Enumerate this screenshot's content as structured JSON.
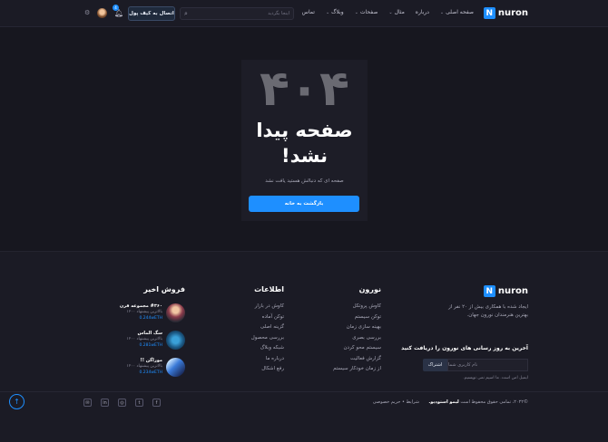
{
  "colors": {
    "accent": "#1e8fff",
    "background": "#17171f",
    "card": "#1d1d27",
    "text_muted": "#a9a9b8"
  },
  "header": {
    "logo_letter": "N",
    "logo_text": "nuron",
    "nav": [
      {
        "label": "صفحه اصلی",
        "chevron": true
      },
      {
        "label": "درباره",
        "chevron": false
      },
      {
        "label": "مثال",
        "chevron": true
      },
      {
        "label": "صفحات",
        "chevron": true
      },
      {
        "label": "وبلاگ",
        "chevron": true
      },
      {
        "label": "تماس",
        "chevron": false
      }
    ],
    "search_placeholder": "اینجا بگردید",
    "connect_wallet": "اتصال به کیف پول",
    "notification_count": "4"
  },
  "error": {
    "code": "۴۰۴",
    "title": "صفحه پیدا نشد!",
    "subtitle": "صفحه ای که دنبالش هستید یافت نشد",
    "back_button": "بازگشت به خانه"
  },
  "footer": {
    "logo_letter": "N",
    "logo_text": "nuron",
    "description": "ایجاد شده با همکاری بیش از ۲۰ نفر از بهترین هنرمندان نورون جهان.",
    "newsletter": {
      "title": "آخرین به روز رسانی های نورون را دریافت کنید",
      "placeholder": "نام کاربری شما",
      "button": "اشتراک",
      "note": "ایمیل امن است. ما اسپم نمی نویسیم."
    },
    "col_nuron": {
      "title": "نورون",
      "items": [
        "کاوش پروتکل",
        "توکن سیستم",
        "بهینه سازی زمان",
        "بررسی بصری",
        "سیستم محو کردن",
        "گزارش فعالیت",
        "از زمان خودکار سیستم"
      ]
    },
    "col_info": {
      "title": "اطلاعات",
      "items": [
        "کاوش در بازار",
        "توکن آماده",
        "گزینه اصلی",
        "بررسی محصول",
        "شبکه وبلاگ",
        "درباره ما",
        "رفع اشکال"
      ]
    },
    "sales": {
      "title": "فروش اخیر",
      "items": [
        {
          "name": "#۳۶۰ مجموعه قرن",
          "bid": "بالاترین پیشنهاد ۱۲۰۰",
          "price": "0.244wETH"
        },
        {
          "name": "سگ الماس",
          "bid": "بالاترین پیشنهاد ۱۲۰۰",
          "price": "0.281wETH"
        },
        {
          "name": "موراگن !!",
          "bid": "بالاترین پیشنهاد ۱۲۰۰",
          "price": "0.234wETH"
        }
      ]
    },
    "copyright_prefix": "©۲۰۲۲، تمامی حقوق محفوظ است ",
    "copyright_brand": "لیمو استودیو.",
    "legal_terms": "شرایط",
    "legal_privacy": "حریم خصوصی",
    "legal_sep": "•"
  }
}
